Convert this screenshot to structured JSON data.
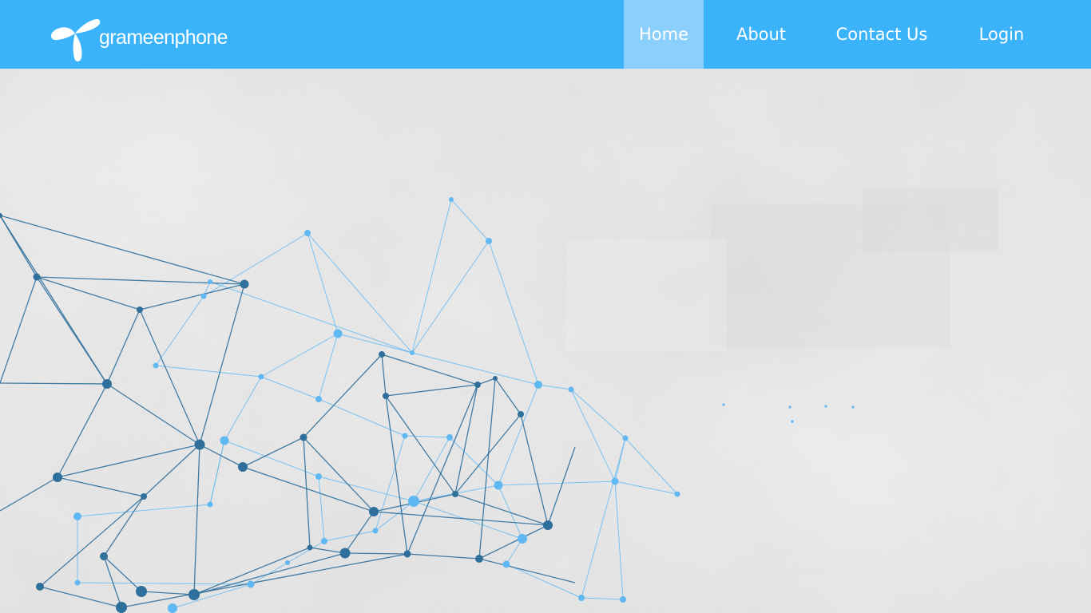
{
  "header": {
    "brand": "grameenphone",
    "logo_icon": "telenor-propeller-icon",
    "background_color": "#3bb3fb",
    "active_tab_color": "#8bd0fc"
  },
  "nav": {
    "items": [
      {
        "label": "Home",
        "active": true
      },
      {
        "label": "About",
        "active": false
      },
      {
        "label": "Contact Us",
        "active": false
      },
      {
        "label": "Login",
        "active": false
      }
    ]
  },
  "hero": {
    "decoration": "network-graph-illustration",
    "dark_line_color": "#2f6f9c",
    "light_line_color": "#5fb8f2"
  }
}
